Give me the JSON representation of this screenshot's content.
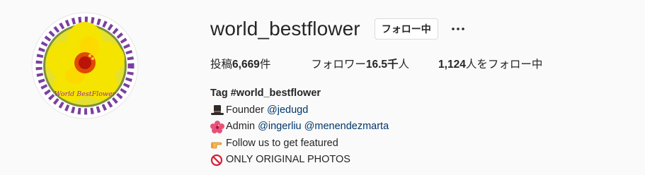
{
  "profile": {
    "username": "world_bestflower",
    "follow_button": "フォロー中",
    "more_icon": "ellipsis-icon",
    "avatar_text": "World BestFlower"
  },
  "stats": {
    "posts_label": "投稿",
    "posts_value": "6,669",
    "posts_suffix": "件",
    "followers_label": "フォロワー",
    "followers_value": "16.5千",
    "followers_suffix": "人",
    "following_value": "1,124",
    "following_suffix": "人をフォロー中"
  },
  "bio": {
    "name": "Tag #world_bestflower",
    "line1_icon": "top-hat-icon",
    "line1_text": "Founder ",
    "line1_mention": "@jedugd",
    "line2_icon": "hibiscus-icon",
    "line2_text": "Admin ",
    "line2_mention1": "@ingerliu",
    "line2_mention2": "@menendezmarta",
    "line3_icon": "pointing-hand-icon",
    "line3_text": "Follow us to get featured",
    "line4_icon": "prohibited-icon",
    "line4_text": "ONLY ORIGINAL PHOTOS"
  },
  "colors": {
    "background": "#fafafa",
    "text": "#262626",
    "link": "#00376b",
    "border": "#dbdbdb"
  }
}
